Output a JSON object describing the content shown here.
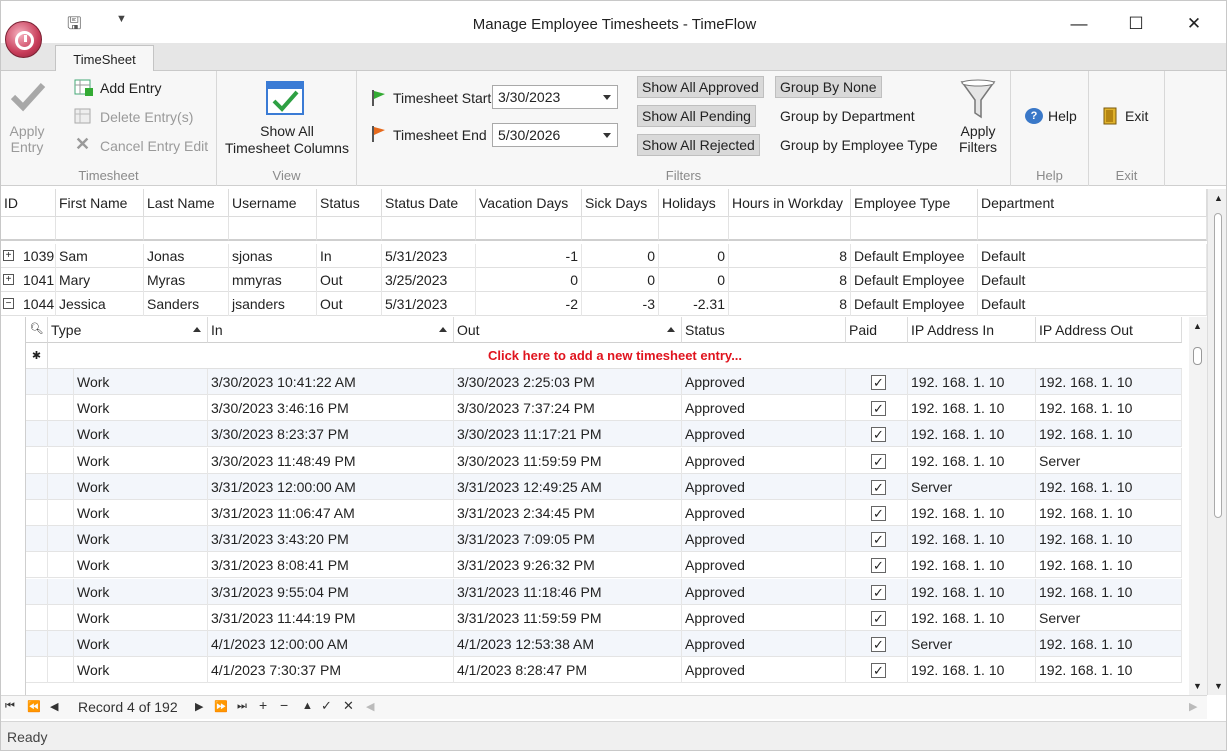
{
  "window": {
    "title": "Manage Employee Timesheets - TimeFlow",
    "minimize": "—",
    "maximize": "☐",
    "close": "✕"
  },
  "ribbon": {
    "tab": "TimeSheet",
    "apply_entry": [
      "Apply",
      "Entry"
    ],
    "add_entry": "Add Entry",
    "delete_entries": "Delete Entry(s)",
    "cancel_entry_edit": "Cancel Entry Edit",
    "group_timesheet": "Timesheet",
    "show_all_columns": [
      "Show All",
      "Timesheet Columns"
    ],
    "group_view": "View",
    "timesheet_start_label": "Timesheet Start",
    "timesheet_start_value": "3/30/2023",
    "timesheet_end_label": "Timesheet End",
    "timesheet_end_value": "5/30/2026",
    "show_all_approved": "Show All Approved",
    "show_all_pending": "Show All Pending",
    "show_all_rejected": "Show All Rejected",
    "group_by_none": "Group By None",
    "group_by_department": "Group by Department",
    "group_by_employee_type": "Group by Employee Type",
    "apply_filters": [
      "Apply",
      "Filters"
    ],
    "group_filters": "Filters",
    "help": "Help",
    "group_help": "Help",
    "exit": "Exit",
    "group_exit": "Exit"
  },
  "grid": {
    "columns": [
      "ID",
      "First Name",
      "Last Name",
      "Username",
      "Status",
      "Status Date",
      "Vacation Days",
      "Sick Days",
      "Holidays",
      "Hours in Workday",
      "Employee Type",
      "Department"
    ],
    "rows": [
      {
        "expander": "+",
        "id": "1039",
        "first": "Sam",
        "last": "Jonas",
        "username": "sjonas",
        "status": "In",
        "status_date": "5/31/2023",
        "vacation": "-1",
        "sick": "0",
        "holidays": "0",
        "hours": "8",
        "type": "Default Employee",
        "dept": "Default"
      },
      {
        "expander": "+",
        "id": "1041",
        "first": "Mary",
        "last": "Myras",
        "username": "mmyras",
        "status": "Out",
        "status_date": "3/25/2023",
        "vacation": "0",
        "sick": "0",
        "holidays": "0",
        "hours": "8",
        "type": "Default Employee",
        "dept": "Default"
      },
      {
        "expander": "−",
        "id": "1044",
        "first": "Jessica",
        "last": "Sanders",
        "username": "jsanders",
        "status": "Out",
        "status_date": "5/31/2023",
        "vacation": "-2",
        "sick": "-3",
        "holidays": "-2.31",
        "hours": "8",
        "type": "Default Employee",
        "dept": "Default"
      }
    ]
  },
  "detail": {
    "columns": [
      "Type",
      "In",
      "Out",
      "Status",
      "Paid",
      "IP Address In",
      "IP Address Out"
    ],
    "new_row_text": "Click here to add a new timesheet entry...",
    "paid_mark": "✓",
    "entries": [
      {
        "type": "Work",
        "in": "3/30/2023 10:41:22 AM",
        "out": "3/30/2023 2:25:03 PM",
        "status": "Approved",
        "ip_in": "192. 168. 1. 10",
        "ip_out": "192. 168. 1. 10"
      },
      {
        "type": "Work",
        "in": "3/30/2023 3:46:16 PM",
        "out": "3/30/2023 7:37:24 PM",
        "status": "Approved",
        "ip_in": "192. 168. 1. 10",
        "ip_out": "192. 168. 1. 10"
      },
      {
        "type": "Work",
        "in": "3/30/2023 8:23:37 PM",
        "out": "3/30/2023 11:17:21 PM",
        "status": "Approved",
        "ip_in": "192. 168. 1. 10",
        "ip_out": "192. 168. 1. 10"
      },
      {
        "type": "Work",
        "in": "3/30/2023 11:48:49 PM",
        "out": "3/30/2023 11:59:59 PM",
        "status": "Approved",
        "ip_in": "192. 168. 1. 10",
        "ip_out": "Server"
      },
      {
        "type": "Work",
        "in": "3/31/2023 12:00:00 AM",
        "out": "3/31/2023 12:49:25 AM",
        "status": "Approved",
        "ip_in": "Server",
        "ip_out": "192. 168. 1. 10"
      },
      {
        "type": "Work",
        "in": "3/31/2023 11:06:47 AM",
        "out": "3/31/2023 2:34:45 PM",
        "status": "Approved",
        "ip_in": "192. 168. 1. 10",
        "ip_out": "192. 168. 1. 10"
      },
      {
        "type": "Work",
        "in": "3/31/2023 3:43:20 PM",
        "out": "3/31/2023 7:09:05 PM",
        "status": "Approved",
        "ip_in": "192. 168. 1. 10",
        "ip_out": "192. 168. 1. 10"
      },
      {
        "type": "Work",
        "in": "3/31/2023 8:08:41 PM",
        "out": "3/31/2023 9:26:32 PM",
        "status": "Approved",
        "ip_in": "192. 168. 1. 10",
        "ip_out": "192. 168. 1. 10"
      },
      {
        "type": "Work",
        "in": "3/31/2023 9:55:04 PM",
        "out": "3/31/2023 11:18:46 PM",
        "status": "Approved",
        "ip_in": "192. 168. 1. 10",
        "ip_out": "192. 168. 1. 10"
      },
      {
        "type": "Work",
        "in": "3/31/2023 11:44:19 PM",
        "out": "3/31/2023 11:59:59 PM",
        "status": "Approved",
        "ip_in": "192. 168. 1. 10",
        "ip_out": "Server"
      },
      {
        "type": "Work",
        "in": "4/1/2023 12:00:00 AM",
        "out": "4/1/2023 12:53:38 AM",
        "status": "Approved",
        "ip_in": "Server",
        "ip_out": "192. 168. 1. 10"
      },
      {
        "type": "Work",
        "in": "4/1/2023 7:30:37 PM",
        "out": "4/1/2023 8:28:47 PM",
        "status": "Approved",
        "ip_in": "192. 168. 1. 10",
        "ip_out": "192. 168. 1. 10"
      }
    ]
  },
  "navigator": {
    "record_text": "Record 4 of 192"
  },
  "statusbar": {
    "text": "Ready"
  },
  "colors": {
    "accent_red": "#e0141e",
    "toggle_bg": "#d9d9d9",
    "ribbon_bg": "#f7f7f7"
  }
}
